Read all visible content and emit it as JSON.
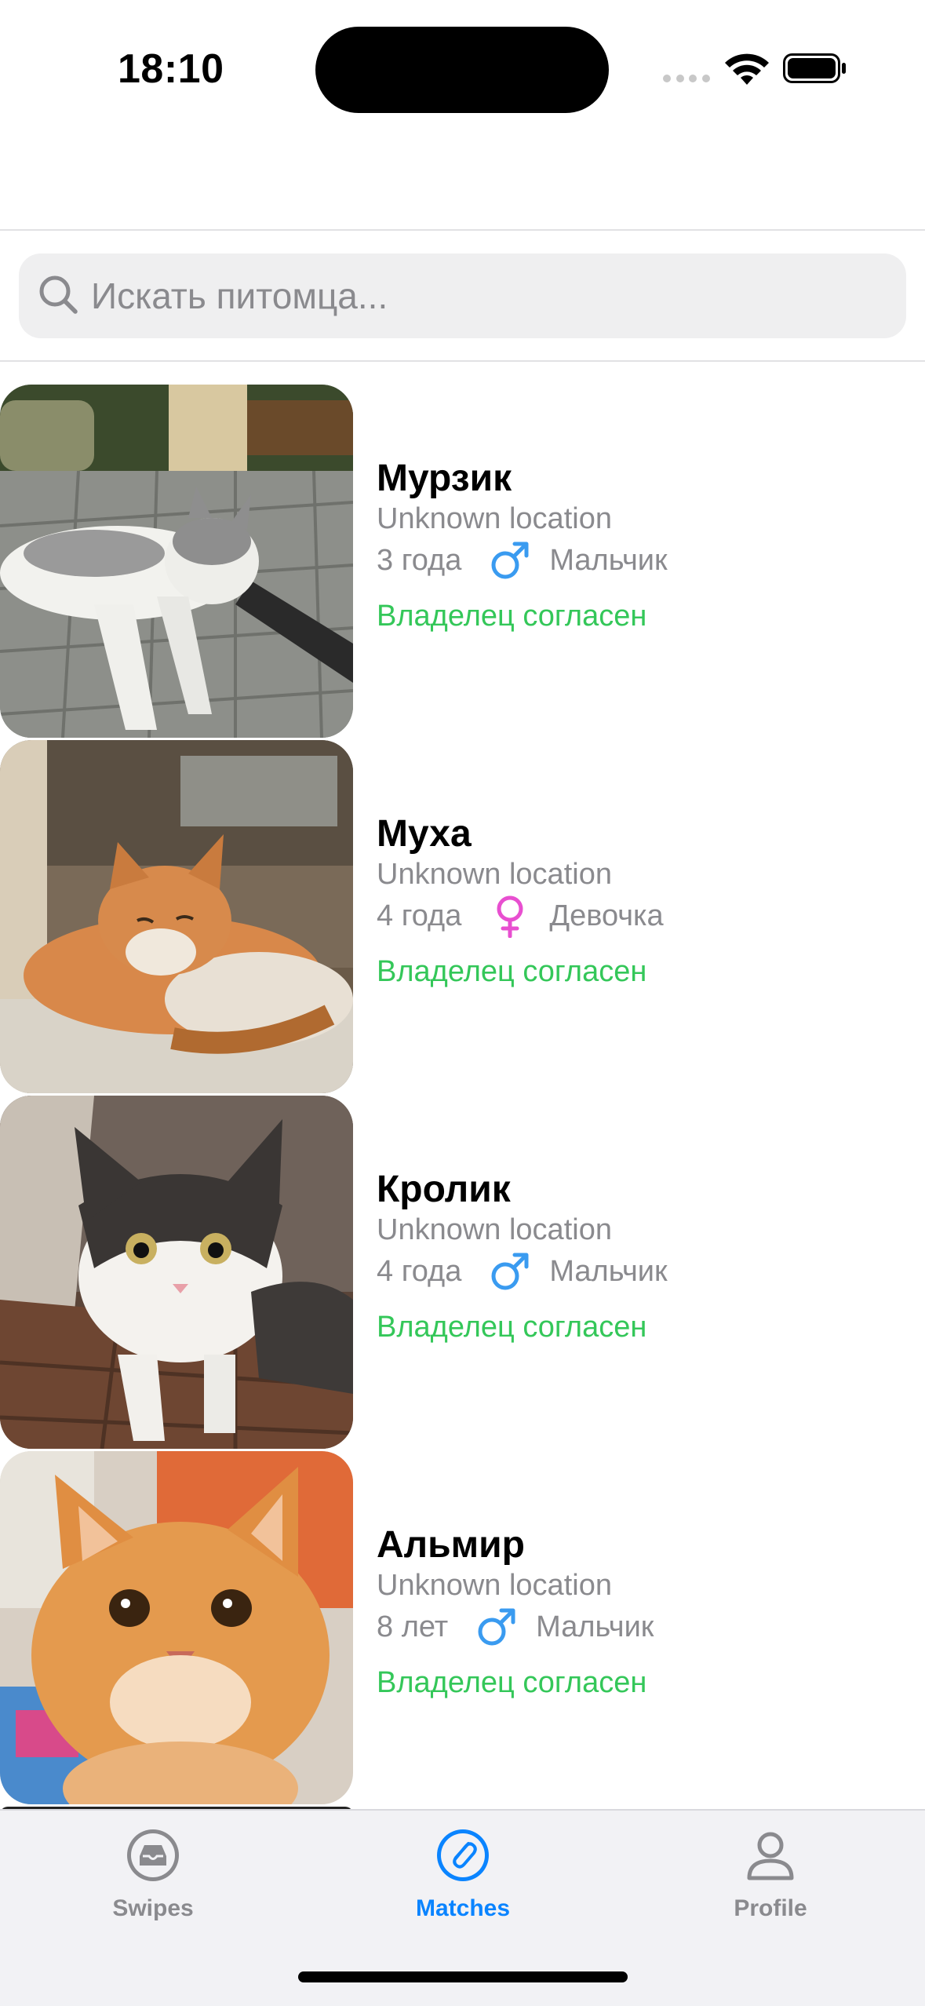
{
  "status_bar": {
    "time": "18:10",
    "icons": [
      "cellular-dots-icon",
      "wifi-icon",
      "battery-icon"
    ]
  },
  "search": {
    "placeholder": "Искать питомца..."
  },
  "pets": [
    {
      "name": "Мурзик",
      "location": "Unknown location",
      "age": "3 года",
      "gender_icon": "male-icon",
      "gender": "Мальчик",
      "status": "Владелец согласен"
    },
    {
      "name": "Муха",
      "location": "Unknown location",
      "age": "4 года",
      "gender_icon": "female-icon",
      "gender": "Девочка",
      "status": "Владелец согласен"
    },
    {
      "name": "Кролик",
      "location": "Unknown location",
      "age": "4 года",
      "gender_icon": "male-icon",
      "gender": "Мальчик",
      "status": "Владелец согласен"
    },
    {
      "name": "Альмир",
      "location": "Unknown location",
      "age": "8 лет",
      "gender_icon": "male-icon",
      "gender": "Мальчик",
      "status": "Владелец согласен"
    }
  ],
  "tabs": [
    {
      "label": "Swipes",
      "icon": "tray-icon",
      "active": false
    },
    {
      "label": "Matches",
      "icon": "paperclip-icon",
      "active": true
    },
    {
      "label": "Profile",
      "icon": "person-icon",
      "active": false
    }
  ],
  "colors": {
    "accent": "#0a84ff",
    "status_green": "#34c759",
    "male_blue": "#3a9bf0",
    "female_pink": "#e84fd0",
    "secondary_text": "#8a8a8e"
  }
}
